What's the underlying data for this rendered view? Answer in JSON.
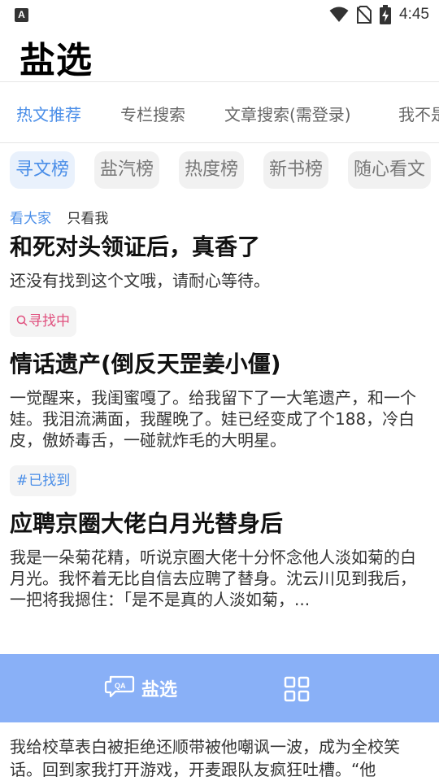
{
  "status_bar": {
    "time": "4:45",
    "left_icon": "A",
    "icons": [
      "wifi-icon",
      "no-sim-icon",
      "battery-charging-icon"
    ]
  },
  "app": {
    "title": "盐选"
  },
  "tabs": [
    "热文推荐",
    "专栏搜索",
    "文章搜索(需登录)",
    "我不是"
  ],
  "active_tab_index": 0,
  "chips": [
    "寻文榜",
    "盐汽榜",
    "热度榜",
    "新书榜",
    "随心看文"
  ],
  "active_chip_index": 0,
  "filter": {
    "everyone": "看大家",
    "only_me": "只看我"
  },
  "cards": [
    {
      "title": "和死对头领证后，真香了",
      "desc": "还没有找到这个文哦，请耐心等待。",
      "badge": "寻找中",
      "badge_icon": "search-icon",
      "badge_color": "#e0507e"
    },
    {
      "title": "情话遗产(倒反天罡姜小僵)",
      "desc": "一觉醒来，我闺蜜嘎了。给我留下了一大笔遗产，和一个娃。我泪流满面，我醒晚了。娃已经变成了个188，冷白皮，傲娇毒舌，一碰就炸毛的大明星。",
      "badge": "已找到",
      "badge_icon": "hash-icon",
      "badge_color": "#4a8ee8"
    },
    {
      "title": "应聘京圈大佬白月光替身后",
      "desc": "我是一朵菊花精，听说京圈大佬十分怀念他人淡如菊的白月光。我怀着无比自信去应聘了替身。沈云川见到我后，一把将我摁住：「是不是真的人淡如菊，..."
    }
  ],
  "last_card_desc": "我给校草表白被拒绝还顺带被他嘲讽一波，成为全校笑话。回到家我打开游戏，开麦跟队友疯狂吐槽。“他",
  "bottom_nav": {
    "home_label": "盐选"
  },
  "colors": {
    "accent": "#4a8ee8",
    "nav_bg": "#89b0f7",
    "pink": "#e0507e"
  }
}
